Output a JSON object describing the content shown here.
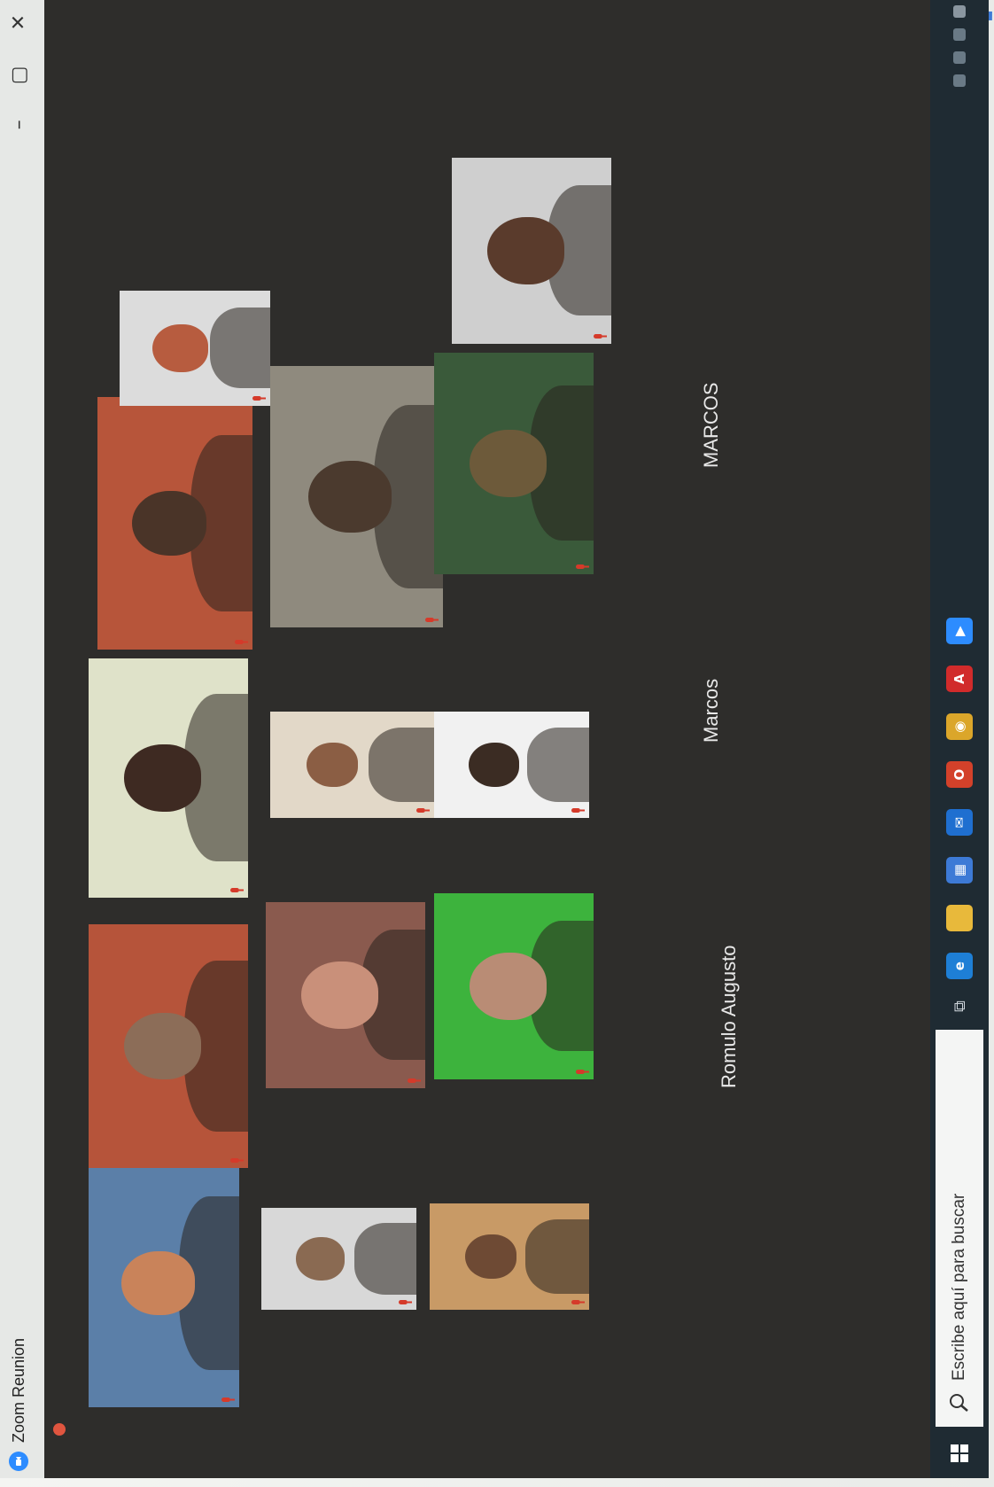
{
  "window": {
    "title": "Zoom Reunion",
    "minimize": "–",
    "maximize": "▢",
    "close": "✕"
  },
  "participants": [
    {
      "name": "",
      "color_bg": "#5b7fa8",
      "color_skin": "#c9835a"
    },
    {
      "name": "",
      "color_bg": "#b6543a",
      "color_skin": "#8c6d58"
    },
    {
      "name": "",
      "color_bg": "#dfe2c9",
      "color_skin": "#3e2a22"
    },
    {
      "name": "",
      "color_bg": "#b7553a",
      "color_skin": "#4a3428"
    },
    {
      "name": "",
      "color_bg": "#dcdcdc",
      "color_skin": "#b75c3f"
    },
    {
      "name": "",
      "color_bg": "#d8d8d8",
      "color_skin": "#8a6a52"
    },
    {
      "name": "",
      "color_bg": "#8a5a4e",
      "color_skin": "#c9907a"
    },
    {
      "name": "",
      "color_bg": "#e2d8c8",
      "color_skin": "#8b5e44"
    },
    {
      "name": "",
      "color_bg": "#8f8a7e",
      "color_skin": "#4b3a2e"
    },
    {
      "name": "",
      "color_bg": "#c89a66",
      "color_skin": "#6e4a34"
    },
    {
      "name": "",
      "color_bg": "#3db33d",
      "color_skin": "#b98c75"
    },
    {
      "name": "",
      "color_bg": "#f1f1f1",
      "color_skin": "#3b2c23"
    },
    {
      "name": "",
      "color_bg": "#3a5a3a",
      "color_skin": "#6d5a3a"
    },
    {
      "name": "",
      "color_bg": "#cfcfcf",
      "color_skin": "#5a3b2c"
    }
  ],
  "name_only": [
    "Romulo Augusto",
    "Marcos",
    "MARCOS"
  ],
  "taskbar": {
    "search_placeholder": "Escribe aquí para buscar",
    "apps": [
      {
        "icon": "edge-icon",
        "color": "#1e7fd6",
        "glyph": "e"
      },
      {
        "icon": "folder-icon",
        "color": "#e8b93b",
        "glyph": ""
      },
      {
        "icon": "store-icon",
        "color": "#3d7ad6",
        "glyph": "▦"
      },
      {
        "icon": "mail-icon",
        "color": "#1f6fd0",
        "glyph": "✉"
      },
      {
        "icon": "office-icon",
        "color": "#d3412a",
        "glyph": "O"
      },
      {
        "icon": "chrome-icon",
        "color": "#dba62a",
        "glyph": "◉"
      },
      {
        "icon": "pdf-icon",
        "color": "#d12b2b",
        "glyph": "A"
      },
      {
        "icon": "zoom-icon",
        "color": "#2d8cff",
        "glyph": "▶"
      }
    ]
  },
  "colors": {
    "screen_bg": "#2e2d2b",
    "active_border": "#d6e04a",
    "mic_muted": "#d53a2a",
    "taskbar_bg": "#1f2b33"
  }
}
